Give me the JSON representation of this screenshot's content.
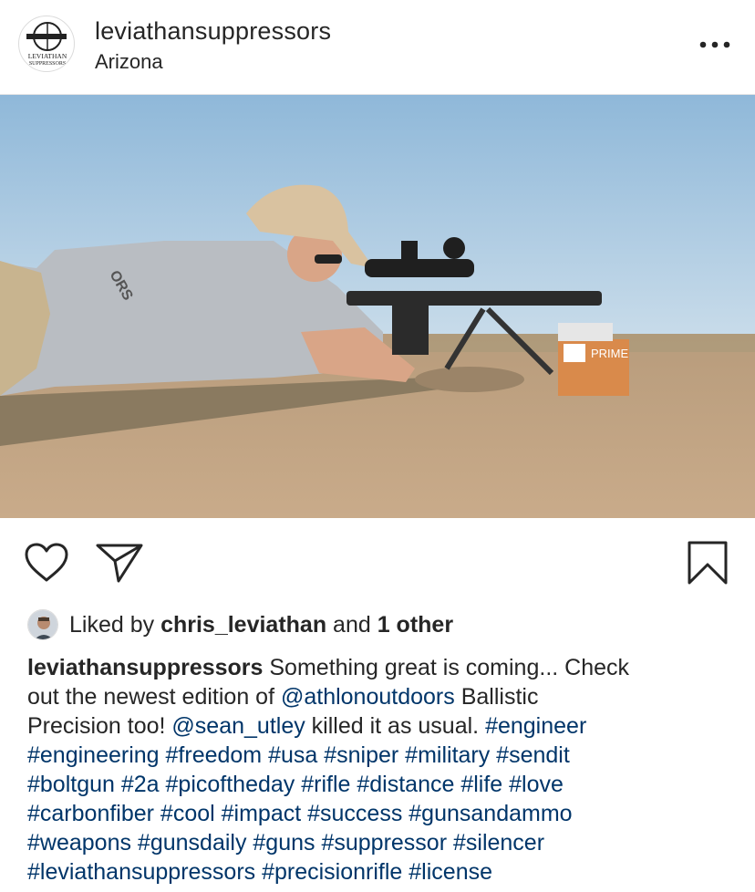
{
  "post": {
    "username": "leviathansuppressors",
    "location": "Arizona",
    "logo_text_top": "LEVIATHAN",
    "logo_text_bottom": "SUPPRESSORS",
    "photo": {
      "shirt_text": "ORS",
      "ammo_box_brand": "PRIME"
    }
  },
  "likes": {
    "prefix": "Liked by ",
    "liker": "chris_leviathan",
    "middle": " and ",
    "others": "1 other"
  },
  "caption": {
    "author": "leviathansuppressors",
    "line1_text": " Something great is coming... Check",
    "line2_pre": "out the newest edition of ",
    "line2_mention": "@athlonoutdoors",
    "line2_post": " Ballistic",
    "line3_pre": "Precision too! ",
    "line3_mention": "@sean_utley",
    "line3_mid": " killed it as usual. ",
    "line3_tag": "#engineer",
    "line4": "#engineering #freedom #usa #sniper #military #sendit",
    "line5": "#boltgun #2a #picoftheday #rifle #distance #life #love",
    "line6": "#carbonfiber #cool #impact #success #gunsandammo",
    "line7": "#weapons #gunsdaily #guns #suppressor #silencer",
    "line8": "#leviathansuppressors #precisionrifle #license"
  },
  "colors": {
    "text": "#262626",
    "link": "#003569",
    "divider": "#e6e6e6"
  },
  "icons": [
    "more-options-icon",
    "heart-icon",
    "send-icon",
    "bookmark-icon"
  ]
}
